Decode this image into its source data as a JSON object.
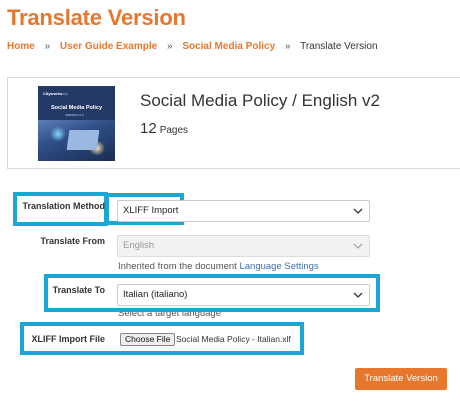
{
  "page": {
    "title": "Translate Version"
  },
  "breadcrumb": {
    "items": [
      "Home",
      "User Guide Example",
      "Social Media Policy"
    ],
    "current": "Translate Version",
    "separator": "»"
  },
  "document": {
    "title": "Social Media Policy / English v2",
    "page_count": "12",
    "page_count_label": "Pages",
    "thumbnail": {
      "brand": "Cityworks",
      "brand_sub": "corp",
      "title": "Social Media Policy",
      "version": "VERSION 2.0"
    }
  },
  "form": {
    "translation_method": {
      "label": "Translation Method",
      "value": "XLIFF Import"
    },
    "translate_from": {
      "label": "Translate From",
      "value": "English",
      "help_text": "Inherited from the document",
      "help_link": "Language Settings"
    },
    "translate_to": {
      "label": "Translate To",
      "value": "Italian (italiano)",
      "help_text": "Select a target language"
    },
    "xliff_import_file": {
      "label": "XLIFF Import File",
      "button_label": "Choose File",
      "file_name": "Social Media Policy - Italian.xlf"
    },
    "submit_label": "Translate Version"
  },
  "colors": {
    "accent": "#e8772e",
    "highlight": "#1aa7d6",
    "link": "#3a70b5"
  },
  "icons": {
    "dropdown": "chevron-down-icon"
  }
}
